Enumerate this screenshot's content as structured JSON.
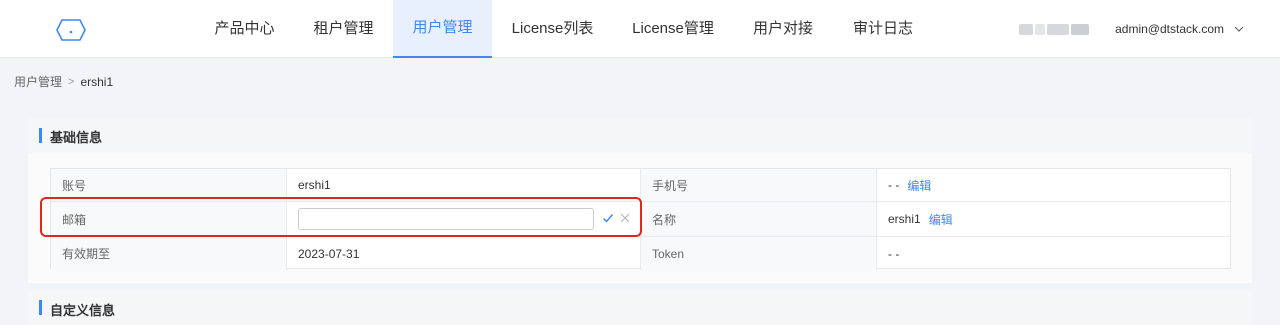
{
  "nav": {
    "items": [
      {
        "label": "产品中心",
        "active": false
      },
      {
        "label": "租户管理",
        "active": false
      },
      {
        "label": "用户管理",
        "active": true
      },
      {
        "label": "License列表",
        "active": false
      },
      {
        "label": "License管理",
        "active": false
      },
      {
        "label": "用户对接",
        "active": false
      },
      {
        "label": "审计日志",
        "active": false
      }
    ]
  },
  "user": {
    "email": "admin@dtstack.com"
  },
  "breadcrumb": {
    "parent": "用户管理",
    "separator": ">",
    "current": "ershi1"
  },
  "basic_info": {
    "title": "基础信息",
    "rows": [
      {
        "label1": "账号",
        "value1": "ershi1",
        "label2": "手机号",
        "value2": "- -",
        "edit2": "编辑"
      },
      {
        "label1": "邮箱",
        "value1": "",
        "label2": "名称",
        "value2": "ershi1",
        "edit2": "编辑"
      },
      {
        "label1": "有效期至",
        "value1": "2023-07-31",
        "label2": "Token",
        "value2": "- -"
      }
    ]
  },
  "custom_info": {
    "title": "自定义信息"
  },
  "colors": {
    "accent": "#3f87f5",
    "highlight": "#e0261f"
  }
}
